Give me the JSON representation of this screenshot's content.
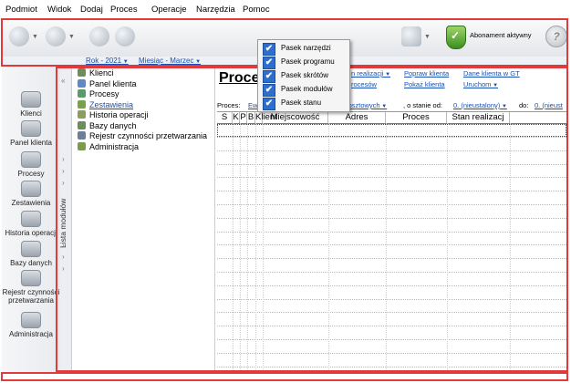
{
  "menubar": [
    "Podmiot",
    "Widok",
    "Dodaj",
    "Proces",
    "Operacje",
    "Narzędzia",
    "Pomoc"
  ],
  "toolbar": {
    "subscription_label": "Abonament aktywny"
  },
  "filter": {
    "year": "Rok - 2021",
    "month": "Miesiąc - Marzec"
  },
  "left_nav": [
    "Klienci",
    "Panel klienta",
    "Procesy",
    "Zestawienia",
    "Historia operacji",
    "Bazy danych",
    "Rejestr czynności przetwarzania",
    "Administracja"
  ],
  "side_panel_label": "Lista modułów",
  "tree": [
    {
      "label": "Klienci",
      "color": "#6b8e5a",
      "link": false
    },
    {
      "label": "Panel klienta",
      "color": "#5d8ac7",
      "link": false
    },
    {
      "label": "Procesy",
      "color": "#5b9a6a",
      "link": false
    },
    {
      "label": "Zestawienia",
      "color": "#7aa04a",
      "link": true
    },
    {
      "label": "Historia operacji",
      "color": "#8aa05a",
      "link": false
    },
    {
      "label": "Bazy danych",
      "color": "#6b8e5a",
      "link": false
    },
    {
      "label": "Rejestr czynności przetwarzania",
      "color": "#6d7f96",
      "link": false
    },
    {
      "label": "Administracja",
      "color": "#7d9a4e",
      "link": false
    }
  ],
  "main": {
    "title": "Proce",
    "links_row1": [
      "n realizacji",
      "Popraw klienta",
      "Dane klienta w GT"
    ],
    "links_row2": [
      "rocesów",
      "Pokaż klienta",
      "Uruchom"
    ],
    "proces_label": "Proces:",
    "proces_value_start": "Ew",
    "proces_value_end": "y kosztowych",
    "stan_od_label": ", o stanie od:",
    "stan_od_value": "0. (nieustalony)",
    "do_label": "do:",
    "do_value": "0. (nieust"
  },
  "grid": {
    "columns": [
      "S",
      "K",
      "P",
      "B",
      "Klient",
      "Miejscowość",
      "Adres",
      "Proces",
      "Stan realizacj"
    ]
  },
  "popup": {
    "items": [
      "Pasek narzędzi",
      "Pasek programu",
      "Pasek skrótów",
      "Pasek modułów",
      "Pasek stanu"
    ],
    "checked": [
      true,
      true,
      true,
      true,
      true
    ]
  }
}
